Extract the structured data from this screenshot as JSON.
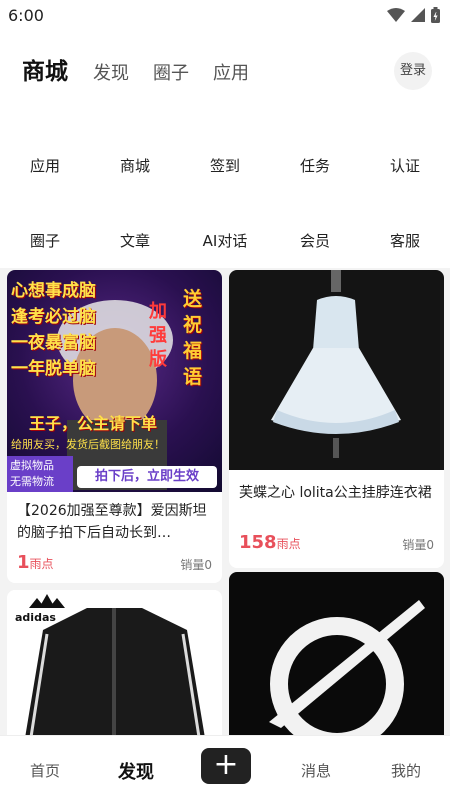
{
  "status_bar": {
    "time": "6:00"
  },
  "nav": {
    "tabs": [
      {
        "label": "商城",
        "active": true
      },
      {
        "label": "发现",
        "active": false
      },
      {
        "label": "圈子",
        "active": false
      },
      {
        "label": "应用",
        "active": false
      }
    ],
    "login_label": "登录"
  },
  "quick_grid": {
    "row1": [
      "应用",
      "商城",
      "签到",
      "任务",
      "认证"
    ],
    "row2": [
      "圈子",
      "文章",
      "AI对话",
      "会员",
      "客服"
    ]
  },
  "products": [
    {
      "image": {
        "lines_left": [
          "心想事成脑",
          "逢考必过脑",
          "一夜暴富脑",
          "一年脱单脑"
        ],
        "tag_right_1": "加强版",
        "tag_right_2": "送祝福语",
        "subtitle": "王子，公主请下单",
        "footer_note": "给朋友买，发货后截图给朋友！",
        "badge_left": "虚拟物品\n无需物流",
        "badge_right": "拍下后，立即生效"
      },
      "title": "【2026加强至尊款】爱因斯坦的脑子拍下后自动长到…",
      "price": "1",
      "price_unit": "雨点",
      "sales": "销量0"
    },
    {
      "title": "芙蝶之心 lolita公主挂脖连衣裙",
      "price": "158",
      "price_unit": "雨点",
      "sales": "销量0"
    },
    {
      "brand_text": "adidas"
    },
    {}
  ],
  "bottom_nav": {
    "items": [
      "首页",
      "发现",
      "消息",
      "我的"
    ],
    "active": "发现"
  },
  "colors": {
    "price": "#e8505b",
    "accent_dark": "#222222",
    "background": "#f3f3f3"
  }
}
